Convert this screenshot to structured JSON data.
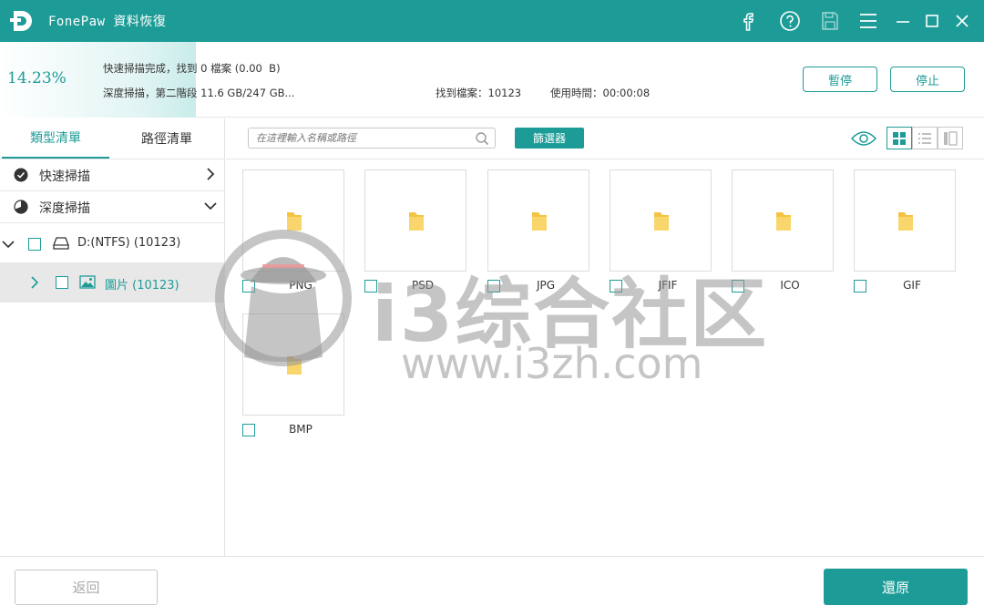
{
  "app": {
    "title": "FonePaw 資料恢復",
    "accent": "#1d9c97",
    "titlebar_icons": [
      "facebook-icon",
      "help-icon",
      "save-icon",
      "menu-icon",
      "minimize-icon",
      "maximize-icon",
      "close-icon"
    ]
  },
  "progress": {
    "percent_text": "14.23%",
    "percent": 14.23,
    "quick_scan_status": "快速掃描完成，找到 0 檔案 (0.00  B)",
    "deep_scan_status": "深度掃描，第二階段 11.6 GB/247 GB...",
    "found_files": "找到檔案：10123",
    "time_used": "使用時間：00:00:08",
    "pause_label": "暫停",
    "stop_label": "停止"
  },
  "sidebar": {
    "tabs": [
      "類型清單",
      "路徑清單"
    ],
    "active_tab": 0,
    "quick_scan_label": "快速掃描",
    "deep_scan_label": "深度掃描",
    "drive_label": "D:(NTFS) (10123)",
    "pictures_label": "圖片 (10123)"
  },
  "toolbar": {
    "search_placeholder": "在這裡輸入名稱或路徑",
    "filter_label": "篩選器"
  },
  "files": [
    {
      "label": "PNG"
    },
    {
      "label": "PSD"
    },
    {
      "label": "JPG"
    },
    {
      "label": "JFIF"
    },
    {
      "label": "ICO"
    },
    {
      "label": "GIF"
    },
    {
      "label": "BMP"
    }
  ],
  "footer": {
    "back_label": "返回",
    "recover_label": "還原"
  },
  "watermark": {
    "text": "i3综合社区",
    "url": "www.i3zh.com"
  }
}
